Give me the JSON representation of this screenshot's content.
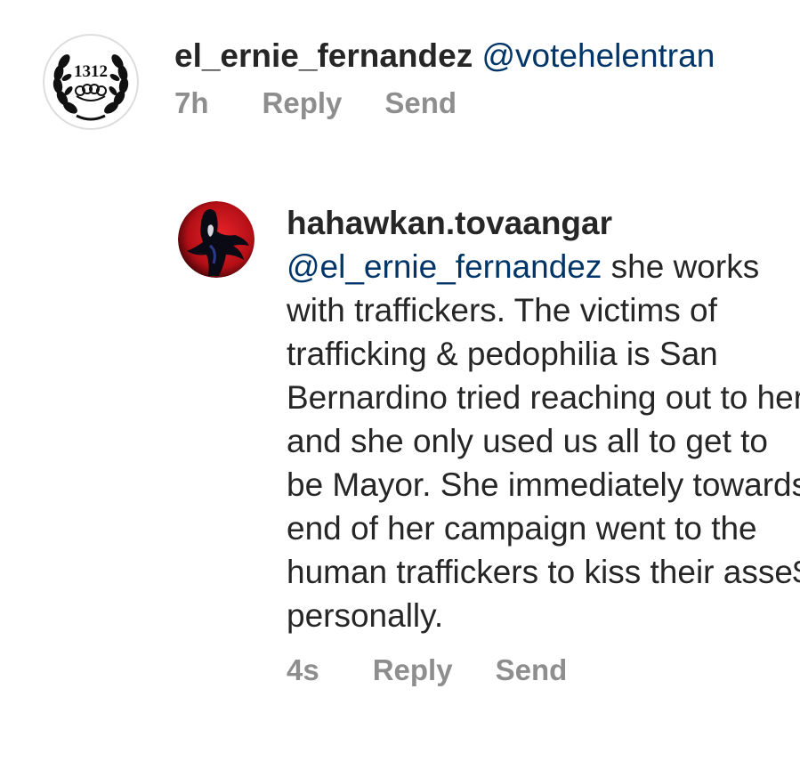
{
  "comments": [
    {
      "username": "el_ernie_fernandez",
      "mention": "@votehelentran",
      "text": "",
      "time": "7h",
      "reply_label": "Reply",
      "send_label": "Send",
      "avatar": {
        "icon": "laurel-wreath-1312-icon",
        "badge_text": "1312"
      }
    },
    {
      "username": "hahawkan.tovaangar",
      "mention": "@el_ernie_fernandez",
      "text": "she works with traffickers. The victims of trafficking & pedophilia is San Bernardino tried reaching out to her and she only used us all to get to be Mayor. She immediately towards end of her campaign went to the human traffickers to kiss their asse$ personally.",
      "time": "4s",
      "reply_label": "Reply",
      "send_label": "Send",
      "avatar": {
        "icon": "red-moon-figure-icon"
      }
    }
  ],
  "colors": {
    "username": "#262626",
    "mention": "#003569",
    "meta": "#8e8e8e",
    "avatar_red": "#c8141c"
  }
}
